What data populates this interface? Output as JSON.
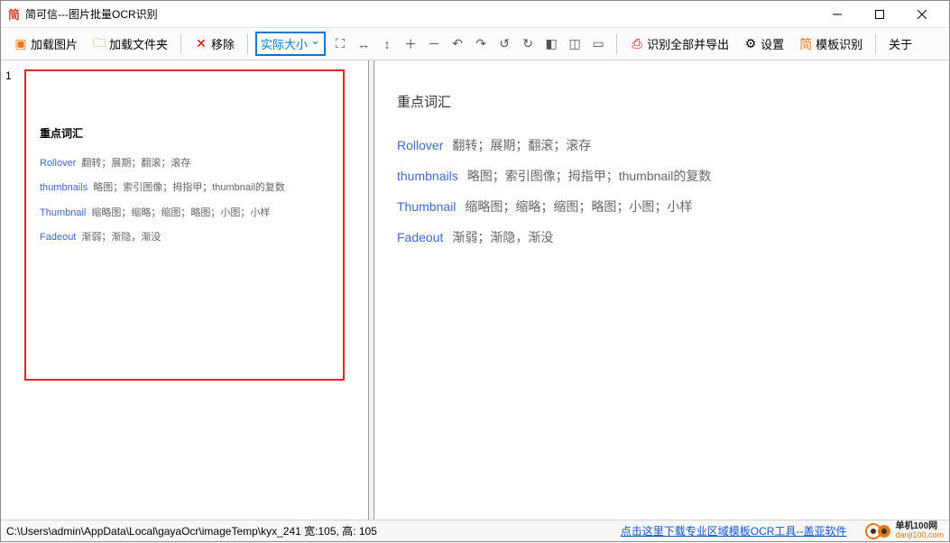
{
  "titlebar": {
    "icon": "简",
    "text": "简可信---图片批量OCR识别"
  },
  "toolbar": {
    "load_image": "加载图片",
    "load_folder": "加载文件夹",
    "remove": "移除",
    "zoom": "实际大小",
    "recognize_export": "识别全部并导出",
    "settings": "设置",
    "template": "模板识别",
    "about": "关于"
  },
  "left": {
    "index": "1",
    "title": "重点词汇",
    "rows": [
      {
        "term": "Rollover",
        "def": "翻转；展期；翻滚；滚存"
      },
      {
        "term": "thumbnails",
        "def": "略图；索引图像；拇指甲；thumbnail的复数"
      },
      {
        "term": "Thumbnail",
        "def": "缩略图；缩略；缩图；略图；小图；小样"
      },
      {
        "term": "Fadeout",
        "def": "渐弱；渐隐，渐没"
      }
    ]
  },
  "right": {
    "title": "重点词汇",
    "rows": [
      {
        "term": "Rollover",
        "def": "翻转；展期；翻滚；滚存"
      },
      {
        "term": "thumbnails",
        "def": "略图；索引图像；拇指甲；thumbnail的复数"
      },
      {
        "term": "Thumbnail",
        "def": "缩略图；缩略；缩图；略图；小图；小样"
      },
      {
        "term": "Fadeout",
        "def": "渐弱；渐隐，渐没"
      }
    ]
  },
  "status": {
    "path": "C:\\Users\\admin\\AppData\\Local\\gayaOcr\\imageTemp\\kyx_241 宽:105, 高: 105",
    "link": "点击这里下载专业区域模板OCR工具--盖亚软件",
    "promo_l1": "单机100网",
    "promo_l2": "danji100.com"
  }
}
